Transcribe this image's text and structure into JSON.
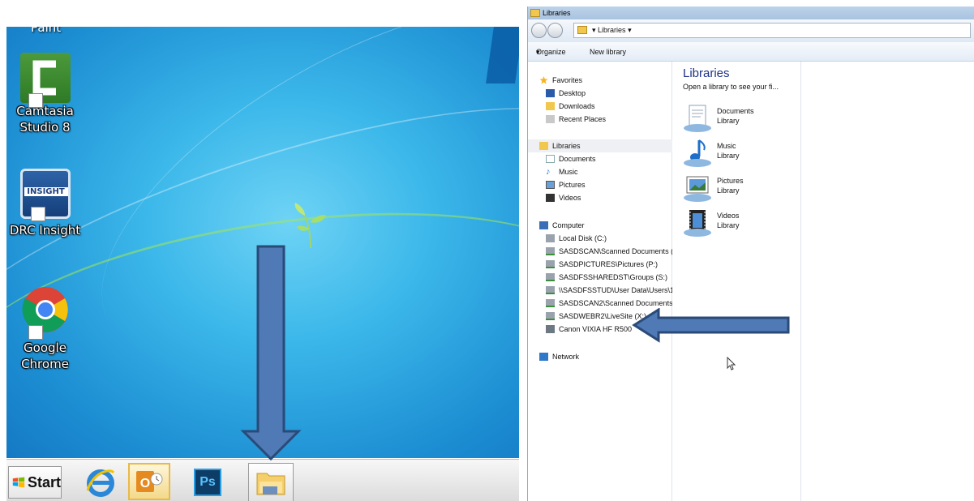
{
  "desktop": {
    "top_partial_label": "Paint",
    "icons": [
      {
        "label_line1": "Camtasia",
        "label_line2": "Studio 8"
      },
      {
        "label_line1": "DRC Insight",
        "label_line2": ""
      },
      {
        "label_line1": "Google",
        "label_line2": "Chrome"
      }
    ],
    "insight_logo_text": "INSIGHT"
  },
  "taskbar": {
    "start_label": "Start",
    "items": [
      "internet-explorer",
      "outlook",
      "photoshop",
      "windows-explorer"
    ],
    "photoshop_text": "Ps"
  },
  "explorer": {
    "window_title": "Libraries",
    "address": "Libraries",
    "toolbar": {
      "organize": "Organize",
      "new_library": "New library"
    },
    "nav": {
      "favorites_header": "Favorites",
      "favorites": [
        "Desktop",
        "Downloads",
        "Recent Places"
      ],
      "libraries_header": "Libraries",
      "libraries": [
        "Documents",
        "Music",
        "Pictures",
        "Videos"
      ],
      "computer_header": "Computer",
      "drives": [
        "Local Disk (C:)",
        "SASDSCAN\\Scanned Documents (",
        "SASDPICTURES\\Pictures (P:)",
        "SASDFSSHAREDST\\Groups (S:)",
        "\\\\SASDFSSTUD\\User Data\\Users\\1",
        "SASDSCAN2\\Scanned Documents",
        "SASDWEBR2\\LiveSite (X:)",
        "Canon VIXIA HF R500"
      ],
      "network_header": "Network"
    },
    "content": {
      "title": "Libraries",
      "subtitle": "Open a library to see your fi...",
      "libraries": [
        {
          "name": "Documents",
          "type": "Library"
        },
        {
          "name": "Music",
          "type": "Library"
        },
        {
          "name": "Pictures",
          "type": "Library"
        },
        {
          "name": "Videos",
          "type": "Library"
        }
      ]
    }
  },
  "colors": {
    "arrow_fill": "#4f7ab6",
    "arrow_stroke": "#2a4a78",
    "desktop_bg": "#2aa3e0"
  }
}
